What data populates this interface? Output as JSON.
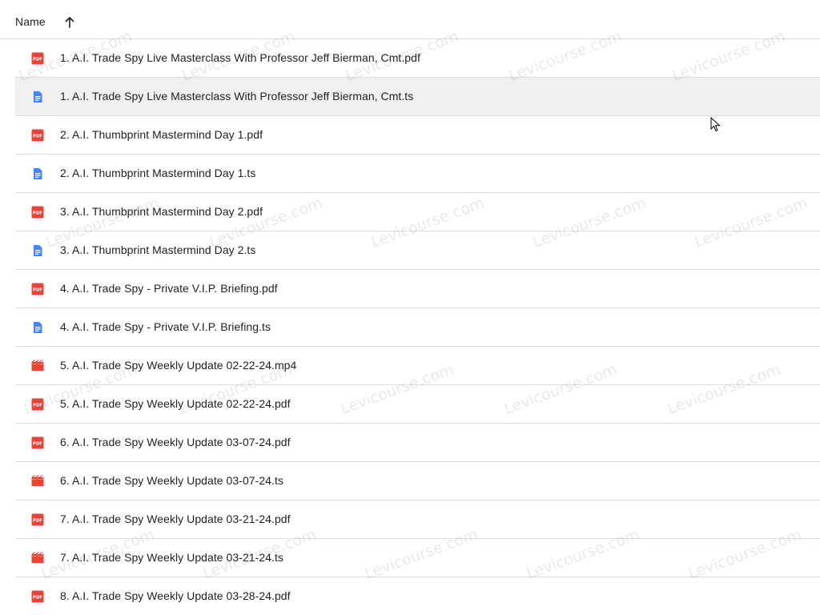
{
  "header": {
    "name_label": "Name",
    "sort_direction": "ascending"
  },
  "files": [
    {
      "name": "1. A.I. Trade Spy Live Masterclass With Professor Jeff Bierman, Cmt.pdf",
      "type": "pdf",
      "selected": false
    },
    {
      "name": "1. A.I. Trade Spy Live Masterclass With Professor Jeff Bierman, Cmt.ts",
      "type": "doc",
      "selected": true
    },
    {
      "name": "2. A.I. Thumbprint Mastermind Day 1.pdf",
      "type": "pdf",
      "selected": false
    },
    {
      "name": "2. A.I. Thumbprint Mastermind Day 1.ts",
      "type": "doc",
      "selected": false
    },
    {
      "name": "3. A.I. Thumbprint Mastermind Day 2.pdf",
      "type": "pdf",
      "selected": false
    },
    {
      "name": "3. A.I. Thumbprint Mastermind Day 2.ts",
      "type": "doc",
      "selected": false
    },
    {
      "name": "4. A.I. Trade Spy - Private V.I.P. Briefing.pdf",
      "type": "pdf",
      "selected": false
    },
    {
      "name": "4. A.I. Trade Spy - Private V.I.P. Briefing.ts",
      "type": "doc",
      "selected": false
    },
    {
      "name": "5. A.I. Trade Spy Weekly Update 02-22-24.mp4",
      "type": "video",
      "selected": false
    },
    {
      "name": "5. A.I. Trade Spy Weekly Update 02-22-24.pdf",
      "type": "pdf",
      "selected": false
    },
    {
      "name": "6. A.I. Trade Spy Weekly Update 03-07-24.pdf",
      "type": "pdf",
      "selected": false
    },
    {
      "name": "6. A.I. Trade Spy Weekly Update 03-07-24.ts",
      "type": "video",
      "selected": false
    },
    {
      "name": "7. A.I. Trade Spy Weekly Update 03-21-24.pdf",
      "type": "pdf",
      "selected": false
    },
    {
      "name": "7. A.I. Trade Spy Weekly Update 03-21-24.ts",
      "type": "video",
      "selected": false
    },
    {
      "name": "8. A.I. Trade Spy Weekly Update 03-28-24.pdf",
      "type": "pdf",
      "selected": false
    }
  ],
  "icons": {
    "pdf": {
      "name": "pdf-icon",
      "color": "#ea4335",
      "label": "PDF"
    },
    "doc": {
      "name": "document-icon",
      "color": "#4285f4"
    },
    "video": {
      "name": "video-icon",
      "color": "#ea4335"
    }
  },
  "watermark_text": "Levicourse.com",
  "colors": {
    "selected_row": "#f0f0f0",
    "divider": "#dadce0",
    "text": "#1f1f1f"
  }
}
